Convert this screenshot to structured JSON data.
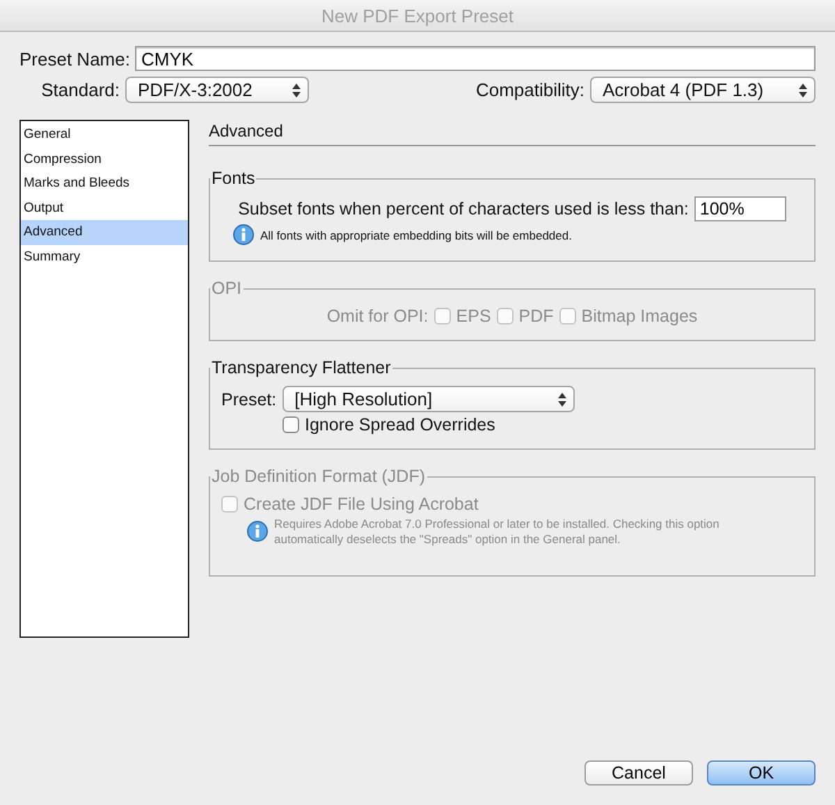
{
  "window": {
    "title": "New PDF Export Preset"
  },
  "preset_name": {
    "label": "Preset Name:",
    "value": "CMYK"
  },
  "standard": {
    "label": "Standard:",
    "value": "PDF/X-3:2002"
  },
  "compatibility": {
    "label": "Compatibility:",
    "value": "Acrobat 4 (PDF 1.3)"
  },
  "sidebar": {
    "items": [
      {
        "label": "General",
        "selected": false
      },
      {
        "label": "Compression",
        "selected": false
      },
      {
        "label": "Marks and Bleeds",
        "selected": false
      },
      {
        "label": "Output",
        "selected": false
      },
      {
        "label": "Advanced",
        "selected": true
      },
      {
        "label": "Summary",
        "selected": false
      }
    ]
  },
  "panel": {
    "title": "Advanced",
    "groups": [
      {
        "kind": "fonts",
        "legend": "Fonts",
        "disabled": false,
        "label": "Subset fonts when percent of characters used is less than:",
        "value": "100%",
        "note": "All fonts with appropriate embedding bits will be embedded."
      },
      {
        "kind": "checks",
        "legend": "OPI",
        "disabled": true,
        "label": "Omit for OPI:",
        "options": [
          {
            "label": "EPS",
            "checked": false
          },
          {
            "label": "PDF",
            "checked": false
          },
          {
            "label": "Bitmap Images",
            "checked": false
          }
        ]
      },
      {
        "kind": "flattener",
        "legend": "Transparency Flattener",
        "disabled": false,
        "preset_label": "Preset:",
        "preset_value": "[High Resolution]",
        "options": [
          {
            "label": "Ignore Spread Overrides",
            "checked": false
          }
        ]
      },
      {
        "kind": "jdf",
        "legend": "Job Definition Format (JDF)",
        "disabled": true,
        "options": [
          {
            "label": "Create JDF File Using Acrobat",
            "checked": false
          }
        ],
        "note": "Requires Adobe Acrobat 7.0 Professional or later to be installed. Checking this option automatically deselects the \"Spreads\" option in the General panel."
      }
    ]
  },
  "buttons": [
    {
      "label": "Cancel",
      "default": false
    },
    {
      "label": "OK",
      "default": true
    }
  ]
}
